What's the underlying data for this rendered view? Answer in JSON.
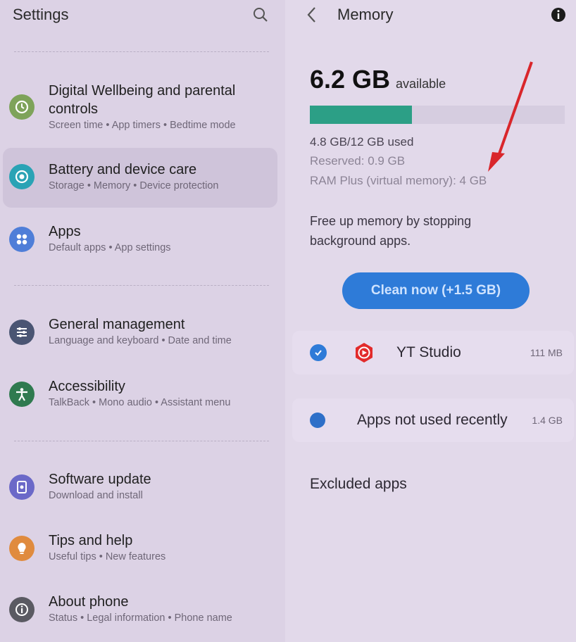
{
  "left": {
    "title": "Settings",
    "items": [
      {
        "title": "Digital Wellbeing and parental controls",
        "title_line1": "Digital Wellbeing and parental",
        "title_line2": "controls",
        "subtitle": "Screen time  •  App timers  •  Bedtime mode",
        "icon": "digital-wellbeing-icon",
        "color": "#7ea35a"
      },
      {
        "title": "Battery and device care",
        "subtitle": "Storage  •  Memory  •  Device protection",
        "icon": "device-care-icon",
        "color": "#2aa3b5"
      },
      {
        "title": "Apps",
        "subtitle": "Default apps  •  App settings",
        "icon": "apps-icon",
        "color": "#4f7ed8"
      },
      {
        "title": "General management",
        "subtitle": "Language and keyboard  •  Date and time",
        "icon": "sliders-icon",
        "color": "#4a5573"
      },
      {
        "title": "Accessibility",
        "subtitle": "TalkBack  •  Mono audio  •  Assistant menu",
        "icon": "accessibility-icon",
        "color": "#2f7a4f"
      },
      {
        "title": "Software update",
        "subtitle": "Download and install",
        "icon": "software-update-icon",
        "color": "#6b69c8"
      },
      {
        "title": "Tips and help",
        "subtitle": "Useful tips  •  New features",
        "icon": "lightbulb-icon",
        "color": "#e08b3e"
      },
      {
        "title": "About phone",
        "subtitle": "Status  •  Legal information  •  Phone name",
        "icon": "info-circle-icon",
        "color": "#5a5a62"
      }
    ]
  },
  "right": {
    "title": "Memory",
    "available_value": "6.2 GB",
    "available_label": "available",
    "used_fraction": 0.4,
    "used": "4.8 GB/12 GB used",
    "reserved": "Reserved: 0.9 GB",
    "ram_plus": "RAM Plus (virtual memory): 4 GB",
    "free_text": "Free up memory by stopping background apps.",
    "clean_button": "Clean now (+1.5 GB)",
    "apps": [
      {
        "name": "YT Studio",
        "size": "111 MB",
        "checked": true
      },
      {
        "name": "Apps not used recently",
        "size": "1.4 GB",
        "checked": true
      }
    ],
    "excluded": "Excluded apps"
  },
  "colors": {
    "accent": "#2e7bd8",
    "bar": "#2c9f86",
    "arrow": "#d9262b"
  }
}
